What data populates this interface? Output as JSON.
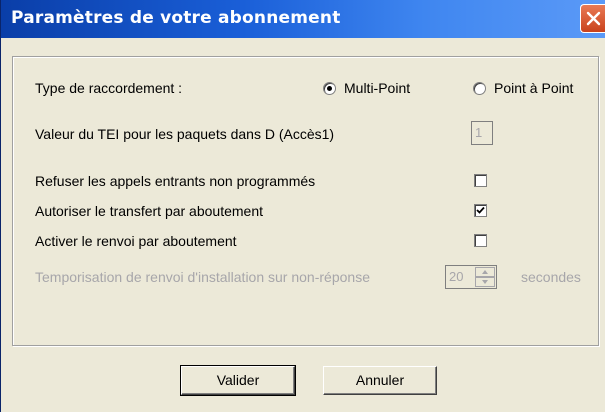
{
  "window": {
    "title": "Paramètres de votre abonnement"
  },
  "connection": {
    "label": "Type de raccordement :",
    "options": [
      {
        "label": "Multi-Point",
        "selected": true
      },
      {
        "label": "Point à Point",
        "selected": false
      }
    ]
  },
  "tei": {
    "label": "Valeur du TEI pour les paquets dans D (Accès1)",
    "value": "1",
    "enabled": false
  },
  "options": [
    {
      "label": "Refuser les appels entrants non programmés",
      "checked": false
    },
    {
      "label": "Autoriser le transfert par aboutement",
      "checked": true
    },
    {
      "label": "Activer le renvoi par aboutement",
      "checked": false
    }
  ],
  "timer": {
    "label": "Temporisation de renvoi d'installation sur non-réponse",
    "value": "20",
    "unit": "secondes",
    "enabled": false
  },
  "buttons": {
    "ok": "Valider",
    "cancel": "Annuler"
  },
  "icons": {
    "close": "close-icon",
    "checkmark": "checkmark-icon",
    "spin-up": "spin-up-icon",
    "spin-down": "spin-down-icon"
  }
}
